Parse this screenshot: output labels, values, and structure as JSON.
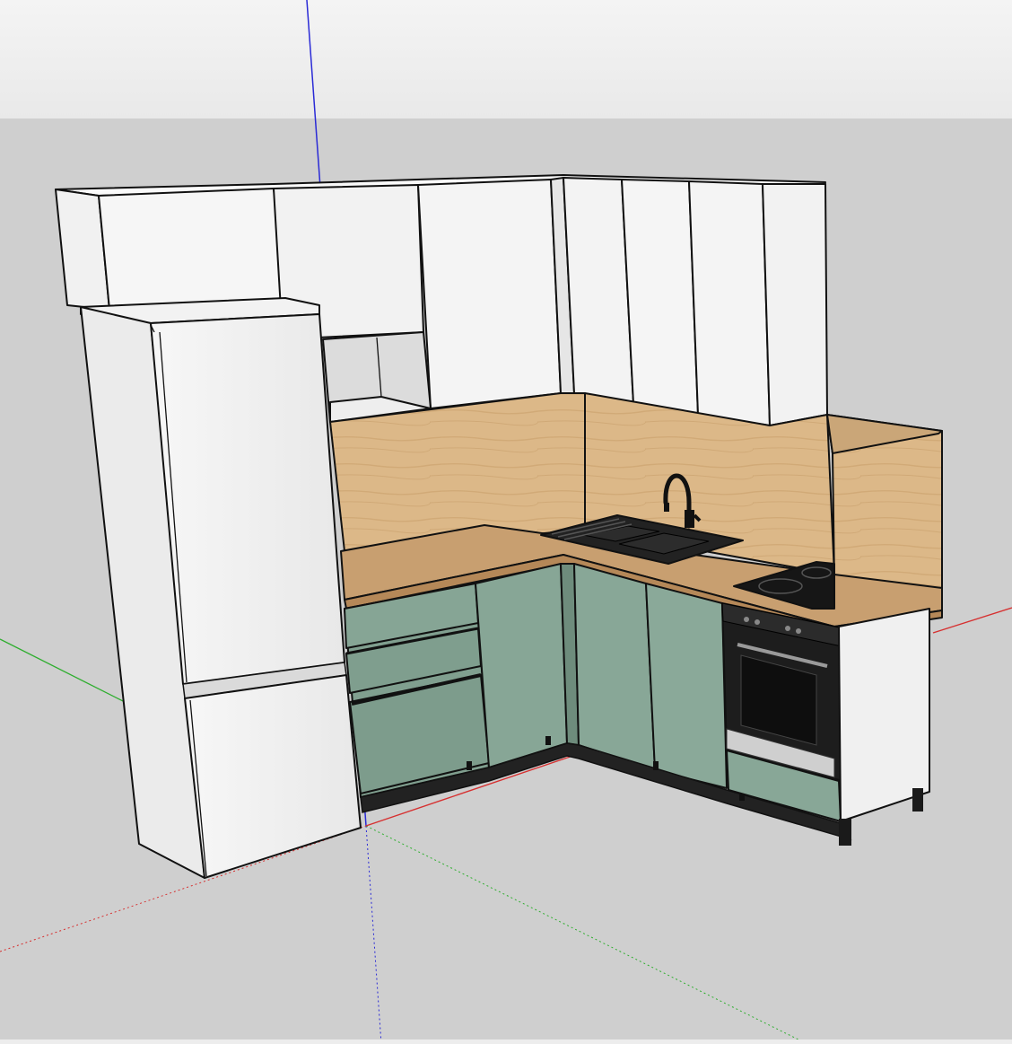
{
  "viewport": {
    "sky_top": "#f4f4f4",
    "sky_bottom": "#e9e9e9",
    "ground": "#cfcfcf"
  },
  "colors": {
    "cabinet_white": "#f3f3f3",
    "cabinet_white_shade": "#e4e4e4",
    "lower_green": "#7f9e8e",
    "lower_green_light": "#8fae9f",
    "wood": "#dcb888",
    "wood_dark": "#c9a06c",
    "countertop": "#c89f70",
    "appliance_black": "#1d1d1d",
    "outline": "#111111",
    "axis_red": "#d63030",
    "axis_green": "#2fae2f",
    "axis_blue": "#2a2ad6"
  },
  "objects": {
    "refrigerator": "refrigerator",
    "sink": "sink",
    "faucet": "faucet-icon",
    "cooktop": "induction-cooktop",
    "oven": "oven"
  }
}
